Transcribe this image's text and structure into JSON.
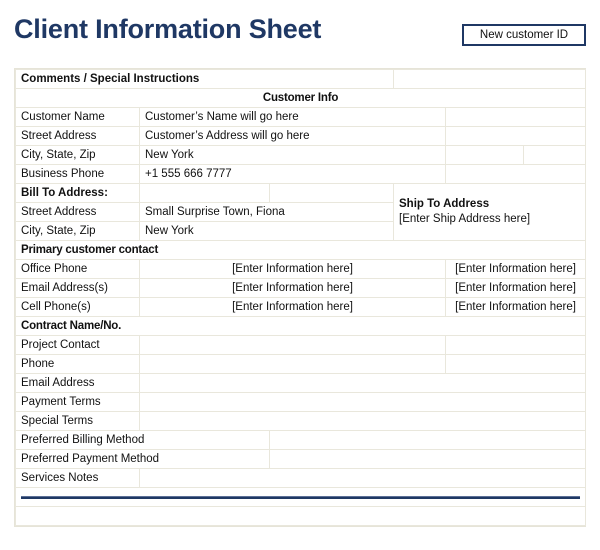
{
  "header": {
    "title": "Client Information Sheet",
    "new_customer_button": "New customer ID",
    "title_color": "#1f3864",
    "button_border_color": "#1f3864"
  },
  "sheet": {
    "comments_label": "Comments / Special Instructions",
    "sections": {
      "customer_info": "Customer Info",
      "primary_contact": "Primary customer contact",
      "contract": "Contract Name/No."
    },
    "customer_info_rows": [
      {
        "label": "Customer Name",
        "value": "Customer’s Name will go here"
      },
      {
        "label": "Street Address",
        "value": "Customer’s Address will go here"
      },
      {
        "label": "City, State, Zip",
        "value": "New York"
      },
      {
        "label": "Business Phone",
        "value": "+1 555 666 7777"
      }
    ],
    "bill_to": {
      "heading": "Bill To Address:",
      "rows": [
        {
          "label": "Street Address",
          "value": "Small Surprise Town, Fiona"
        },
        {
          "label": "City, State, Zip",
          "value": "New York"
        }
      ]
    },
    "ship_to": {
      "heading": "Ship To Address",
      "placeholder": "[Enter Ship Address here]"
    },
    "primary_contact_rows": [
      {
        "label": "Office Phone",
        "value": "[Enter Information here]",
        "value2": "[Enter Information here]"
      },
      {
        "label": "Email Address(s)",
        "value": "[Enter Information here]",
        "value2": "[Enter Information here]"
      },
      {
        "label": "Cell Phone(s)",
        "value": "[Enter Information here]",
        "value2": "[Enter Information here]"
      }
    ],
    "contract_rows": [
      {
        "label": "Project Contact",
        "value": ""
      },
      {
        "label": "Phone",
        "value": ""
      },
      {
        "label": "Email Address",
        "value": ""
      },
      {
        "label": "Payment Terms",
        "value": ""
      },
      {
        "label": "Special Terms",
        "value": ""
      },
      {
        "label": "Preferred Billing Method",
        "value": ""
      },
      {
        "label": "Preferred Payment Method",
        "value": ""
      },
      {
        "label": "Services Notes",
        "value": ""
      }
    ]
  }
}
